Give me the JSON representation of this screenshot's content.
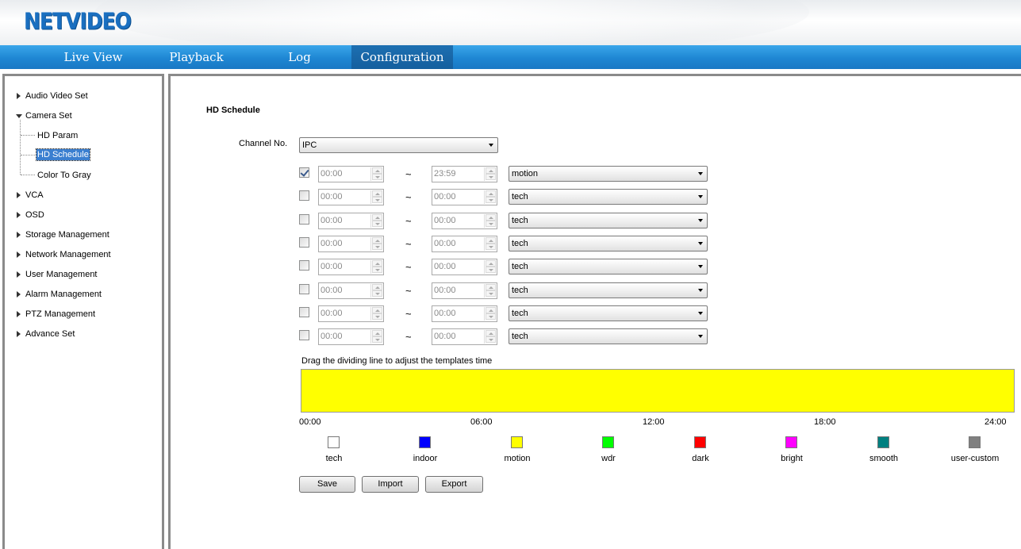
{
  "app": {
    "logo": "NETVIDEO"
  },
  "nav": {
    "items": [
      {
        "label": "Live View"
      },
      {
        "label": "Playback"
      },
      {
        "label": "Log"
      },
      {
        "label": "Configuration"
      }
    ],
    "active": "Configuration"
  },
  "sidebar": {
    "items": [
      {
        "label": "Audio Video Set"
      },
      {
        "label": "Camera Set"
      },
      {
        "label": "HD Param"
      },
      {
        "label": "HD Schedule"
      },
      {
        "label": "Color To Gray"
      },
      {
        "label": "VCA"
      },
      {
        "label": "OSD"
      },
      {
        "label": "Storage Management"
      },
      {
        "label": "Network Management"
      },
      {
        "label": "User Management"
      },
      {
        "label": "Alarm Management"
      },
      {
        "label": "PTZ Management"
      },
      {
        "label": "Advance Set"
      }
    ]
  },
  "main": {
    "title": "HD Schedule",
    "channel_label": "Channel No.",
    "channel_value": "IPC",
    "separator": "~",
    "rows": [
      {
        "checked": true,
        "start": "00:00",
        "end": "23:59",
        "mode": "motion"
      },
      {
        "checked": false,
        "start": "00:00",
        "end": "00:00",
        "mode": "tech"
      },
      {
        "checked": false,
        "start": "00:00",
        "end": "00:00",
        "mode": "tech"
      },
      {
        "checked": false,
        "start": "00:00",
        "end": "00:00",
        "mode": "tech"
      },
      {
        "checked": false,
        "start": "00:00",
        "end": "00:00",
        "mode": "tech"
      },
      {
        "checked": false,
        "start": "00:00",
        "end": "00:00",
        "mode": "tech"
      },
      {
        "checked": false,
        "start": "00:00",
        "end": "00:00",
        "mode": "tech"
      },
      {
        "checked": false,
        "start": "00:00",
        "end": "00:00",
        "mode": "tech"
      }
    ],
    "timeline_hint": "Drag the dividing line to adjust the templates time",
    "timeline_color": "#ffff00",
    "ticks": [
      "00:00",
      "06:00",
      "12:00",
      "18:00",
      "24:00"
    ],
    "legend": [
      {
        "label": "tech",
        "color": "#ffffff"
      },
      {
        "label": "indoor",
        "color": "#0000ff"
      },
      {
        "label": "motion",
        "color": "#ffff00"
      },
      {
        "label": "wdr",
        "color": "#00ff00"
      },
      {
        "label": "dark",
        "color": "#ff0000"
      },
      {
        "label": "bright",
        "color": "#ff00ff"
      },
      {
        "label": "smooth",
        "color": "#008080"
      },
      {
        "label": "user-custom",
        "color": "#808080"
      }
    ],
    "buttons": {
      "save": "Save",
      "import": "Import",
      "export": "Export"
    }
  }
}
